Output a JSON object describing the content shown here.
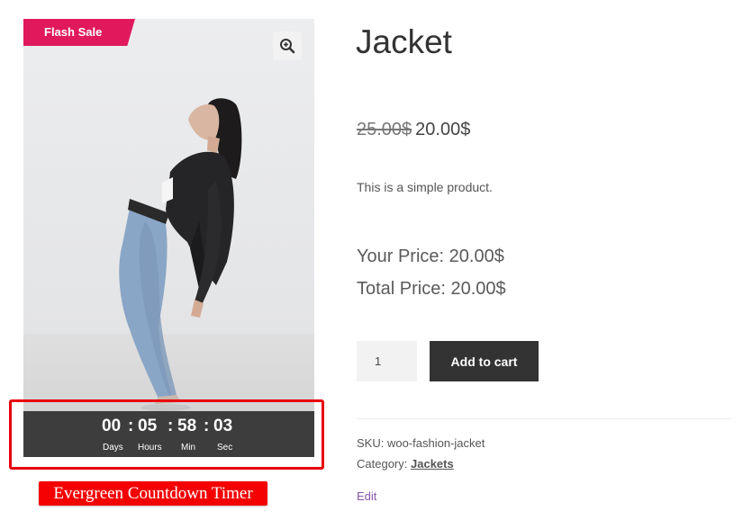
{
  "product": {
    "badge": "Flash Sale",
    "title": "Jacket",
    "old_price": "25.00$",
    "price": "20.00$",
    "description": "This is a simple product.",
    "your_price": "Your Price: 20.00$",
    "total_price": "Total Price: 20.00$",
    "quantity": "1",
    "add_to_cart": "Add to cart",
    "sku_label": "SKU:",
    "sku": "woo-fashion-jacket",
    "category_label": "Category:",
    "category": "Jackets",
    "edit": "Edit"
  },
  "timer": {
    "days": "00",
    "hours": "05",
    "minutes": "58",
    "seconds": "03",
    "separator": ":",
    "labels": {
      "days": "Days",
      "hours": "Hours",
      "minutes": "Min",
      "seconds": "Sec"
    }
  },
  "annotation": {
    "caption": "Evergreen Countdown Timer",
    "highlight_color": "#e8000b"
  },
  "icons": {
    "zoom": "zoom-in-icon"
  },
  "colors": {
    "badge": "#e0195d",
    "button": "#333333",
    "timer_bg": "#3d3d3d",
    "caption_bg": "#f40102"
  }
}
